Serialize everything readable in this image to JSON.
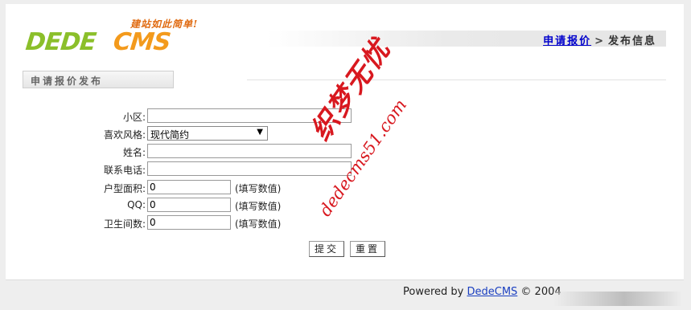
{
  "logo": {
    "slogan": "建站如此简单!",
    "wordmark_a": "DEDE",
    "wordmark_b": "CMS"
  },
  "breadcrumb": {
    "link": "申请报价",
    "sep": ">",
    "current": "发布信息"
  },
  "section_tab": "申请报价发布",
  "form": {
    "community_label": "小区:",
    "community_value": "",
    "style_label": "喜欢风格:",
    "style_selected": "现代简约",
    "name_label": "姓名:",
    "name_value": "",
    "phone_label": "联系电话:",
    "phone_value": "",
    "area_label": "户型面积:",
    "area_value": "0",
    "area_hint": "(填写数值)",
    "qq_label": "QQ:",
    "qq_value": "0",
    "qq_hint": "(填写数值)",
    "bath_label": "卫生间数:",
    "bath_value": "0",
    "bath_hint": "(填写数值)",
    "submit_label": "提交",
    "reset_label": "重置"
  },
  "watermark": {
    "cn": "织梦无忧",
    "en": "dedecms51.com"
  },
  "footer": {
    "prefix": "Powered by ",
    "link": "DedeCMS",
    "suffix": " © 2004"
  },
  "colors": {
    "link": "#0000cc",
    "watermark": "#d8181f",
    "logo_green": "#8bbf2a",
    "logo_orange": "#f39a1c"
  }
}
